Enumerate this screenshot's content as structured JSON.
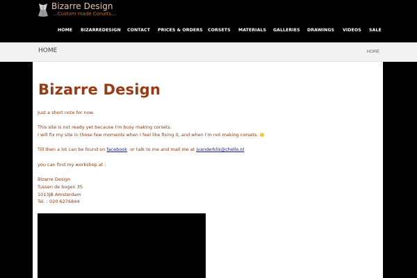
{
  "header": {
    "site_title": "Bizarre Design",
    "tagline": "...Custom made Corsets..."
  },
  "nav": {
    "items": [
      {
        "label": "HOME"
      },
      {
        "label": "BIZARREDESIGN"
      },
      {
        "label": "CONTACT"
      },
      {
        "label": "PRICES & ORDERS"
      },
      {
        "label": "CORSETS"
      },
      {
        "label": "MATERIALS"
      },
      {
        "label": "GALLERIES"
      },
      {
        "label": "DRAWINGS"
      },
      {
        "label": "VIDEOS"
      },
      {
        "label": "SALE"
      }
    ]
  },
  "breadcrumb": {
    "title": "HOME",
    "link": "HOME"
  },
  "main": {
    "heading": "Bizarre Design",
    "line1": "Just a short note for now.",
    "line2": "This site is not ready yet because I'm busy making corsets.",
    "line3": "I will fix my site in those few moments when I feel like fixing it, and when I'm not making corsets.",
    "line4_prefix": "Till then a lot can be found on",
    "facebook_link": "facebook",
    "line4_middle": "  or talk to me and mail me at",
    "email_link": "jvanderklis@chello.nl",
    "line5": "you can find my workshop at :",
    "address": {
      "name": "Bizarre Design",
      "street": "Tussen de bogen 35",
      "city": "1013JB  Amsterdam",
      "phone": "Tel. : 020 6276844"
    }
  }
}
